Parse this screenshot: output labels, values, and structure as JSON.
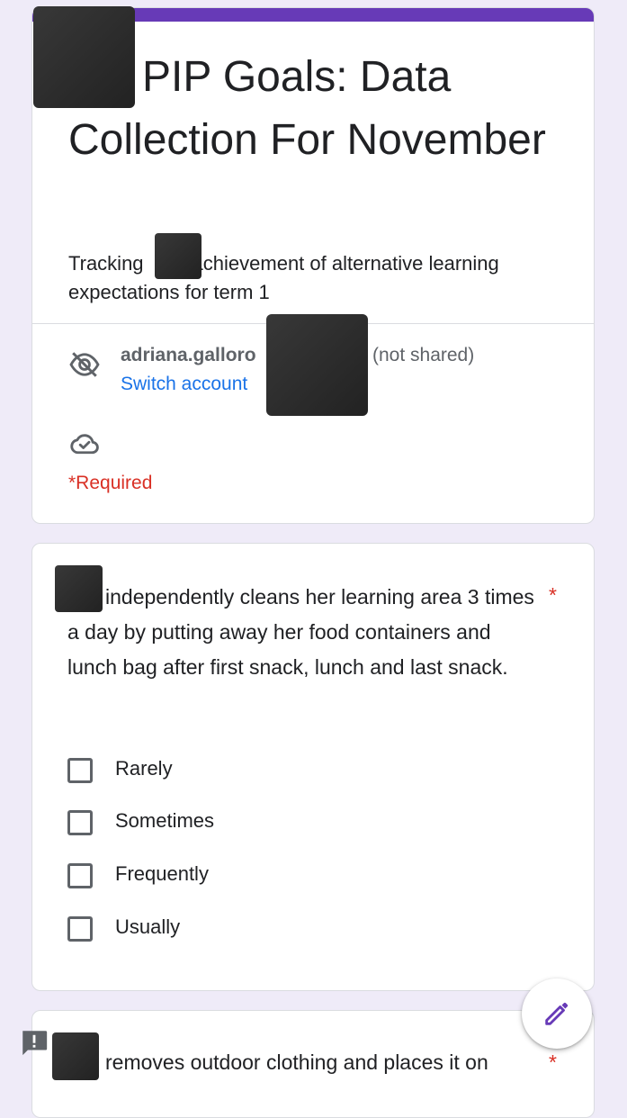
{
  "form": {
    "title": "PIP Goals: Data Collection For November",
    "description_before": "Tracking",
    "description_after": "achievement of alternative learning expectations for term 1",
    "accent_color": "#673ab7"
  },
  "account": {
    "email_partial": "adriana.galloro",
    "not_shared": "(not shared)",
    "switch_label": "Switch account",
    "icon": "eye-off-icon"
  },
  "status": {
    "cloud_icon": "cloud-done-icon"
  },
  "required_note": "*Required",
  "question_1": {
    "text": "independently cleans her learning area 3 times a day by putting away her food containers and lunch bag after first snack, lunch and last snack.",
    "required_mark": "*",
    "options": [
      "Rarely",
      "Sometimes",
      "Frequently",
      "Usually"
    ]
  },
  "question_2": {
    "text_visible": "removes outdoor clothing and places it on",
    "required_mark": "*"
  },
  "fab": {
    "icon": "pencil-icon"
  },
  "feedback": {
    "icon": "feedback-icon"
  }
}
